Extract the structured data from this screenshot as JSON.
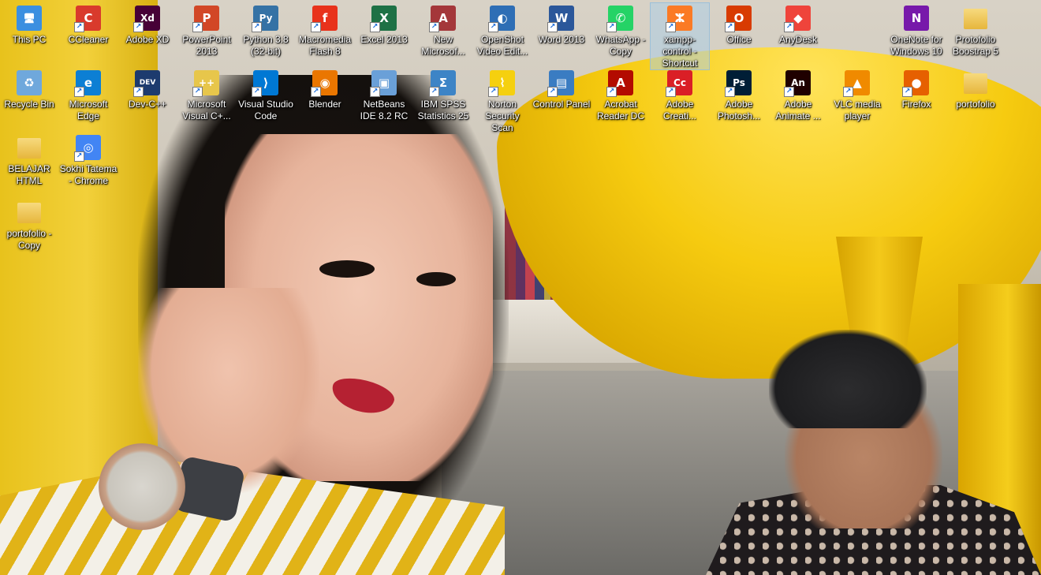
{
  "desktop": {
    "icons": [
      {
        "label": "This PC",
        "glyph": "🖥",
        "bg": "#3b8fe0",
        "icon": "this-pc-icon",
        "shortcut": false
      },
      {
        "label": "CCleaner",
        "glyph": "C",
        "bg": "#d93a2c",
        "icon": "ccleaner-icon",
        "shortcut": true
      },
      {
        "label": "Adobe XD",
        "glyph": "Xd",
        "bg": "#470137",
        "icon": "adobe-xd-icon",
        "shortcut": true
      },
      {
        "label": "PowerPoint 2013",
        "glyph": "P",
        "bg": "#d24726",
        "icon": "powerpoint-icon",
        "shortcut": true
      },
      {
        "label": "Python 3.8 (32-bit)",
        "glyph": "Py",
        "bg": "#3572a5",
        "icon": "python-icon",
        "shortcut": true
      },
      {
        "label": "Macromedia Flash 8",
        "glyph": "f",
        "bg": "#e8321b",
        "icon": "flash-icon",
        "shortcut": true
      },
      {
        "label": "Excel 2013",
        "glyph": "X",
        "bg": "#1e7145",
        "icon": "excel-icon",
        "shortcut": true
      },
      {
        "label": "New Microsof...",
        "glyph": "A",
        "bg": "#a4373a",
        "icon": "access-icon",
        "shortcut": true
      },
      {
        "label": "OpenShot Video Edit...",
        "glyph": "◐",
        "bg": "#2e6eb5",
        "icon": "openshot-icon",
        "shortcut": true
      },
      {
        "label": "Word 2013",
        "glyph": "W",
        "bg": "#2b579a",
        "icon": "word-icon",
        "shortcut": true
      },
      {
        "label": "WhatsApp - Copy",
        "glyph": "✆",
        "bg": "#25d366",
        "icon": "whatsapp-icon",
        "shortcut": true
      },
      {
        "label": "xampp-control - Shortcut",
        "glyph": "ⵣ",
        "bg": "#fb7a24",
        "icon": "xampp-icon",
        "shortcut": true,
        "selected": true
      },
      {
        "label": "Office",
        "glyph": "O",
        "bg": "#d83b01",
        "icon": "office-icon",
        "shortcut": true
      },
      {
        "label": "AnyDesk",
        "glyph": "◆",
        "bg": "#ef443b",
        "icon": "anydesk-icon",
        "shortcut": true
      },
      {
        "label": "OneNote for Windows 10",
        "glyph": "N",
        "bg": "#7719aa",
        "icon": "onenote-icon",
        "shortcut": false
      },
      {
        "label": "Protofolio Boostrap 5",
        "glyph": "",
        "bg": "folder",
        "icon": "folder-icon",
        "shortcut": false
      },
      {
        "label": "Recycle Bin",
        "glyph": "♻",
        "bg": "#6fa8dc",
        "icon": "recycle-bin-icon",
        "shortcut": false
      },
      {
        "label": "Microsoft Edge",
        "glyph": "e",
        "bg": "#0c7fd4",
        "icon": "edge-icon",
        "shortcut": true
      },
      {
        "label": "Dev-C++",
        "glyph": "DEV",
        "bg": "#1d3b6e",
        "icon": "dev-cpp-icon",
        "shortcut": true
      },
      {
        "label": "Microsoft Visual C+...",
        "glyph": "++",
        "bg": "#e7c64b",
        "icon": "visual-cpp-icon",
        "shortcut": true
      },
      {
        "label": "Visual Studio Code",
        "glyph": "⟩",
        "bg": "#0078d4",
        "icon": "vscode-icon",
        "shortcut": true
      },
      {
        "label": "Blender",
        "glyph": "◉",
        "bg": "#ea7600",
        "icon": "blender-icon",
        "shortcut": true
      },
      {
        "label": "NetBeans IDE 8.2 RC",
        "glyph": "▣",
        "bg": "#6aa0d8",
        "icon": "netbeans-icon",
        "shortcut": true
      },
      {
        "label": "IBM SPSS Statistics 25",
        "glyph": "Σ",
        "bg": "#3d84c6",
        "icon": "spss-icon",
        "shortcut": true
      },
      {
        "label": "Norton Security Scan",
        "glyph": "⌇",
        "bg": "#f5d00f",
        "icon": "norton-icon",
        "shortcut": true
      },
      {
        "label": "Control Panel",
        "glyph": "▤",
        "bg": "#3a7cc2",
        "icon": "control-panel-icon",
        "shortcut": true
      },
      {
        "label": "Acrobat Reader DC",
        "glyph": "A",
        "bg": "#b30b00",
        "icon": "acrobat-icon",
        "shortcut": true
      },
      {
        "label": "Adobe Creati...",
        "glyph": "Cc",
        "bg": "#da1f26",
        "icon": "creative-cloud-icon",
        "shortcut": true
      },
      {
        "label": "Adobe Photosh...",
        "glyph": "Ps",
        "bg": "#001e36",
        "icon": "photoshop-icon",
        "shortcut": true
      },
      {
        "label": "Adobe Animate ...",
        "glyph": "An",
        "bg": "#1f0000",
        "icon": "animate-icon",
        "shortcut": true
      },
      {
        "label": "VLC media player",
        "glyph": "▲",
        "bg": "#f08a00",
        "icon": "vlc-icon",
        "shortcut": true
      },
      {
        "label": "Firefox",
        "glyph": "●",
        "bg": "#e66000",
        "icon": "firefox-icon",
        "shortcut": true
      },
      {
        "label": "portofolio",
        "glyph": "",
        "bg": "folder",
        "icon": "folder-icon",
        "shortcut": false
      },
      {
        "label": "BELAJAR HTML",
        "glyph": "",
        "bg": "folder",
        "icon": "folder-icon",
        "shortcut": false
      },
      {
        "label": "Sokhi Tatema - Chrome",
        "glyph": "◎",
        "bg": "#4285f4",
        "icon": "chrome-icon",
        "shortcut": true
      },
      {
        "label": "portofolio - Copy",
        "glyph": "",
        "bg": "folder",
        "icon": "folder-icon",
        "shortcut": false
      }
    ]
  }
}
